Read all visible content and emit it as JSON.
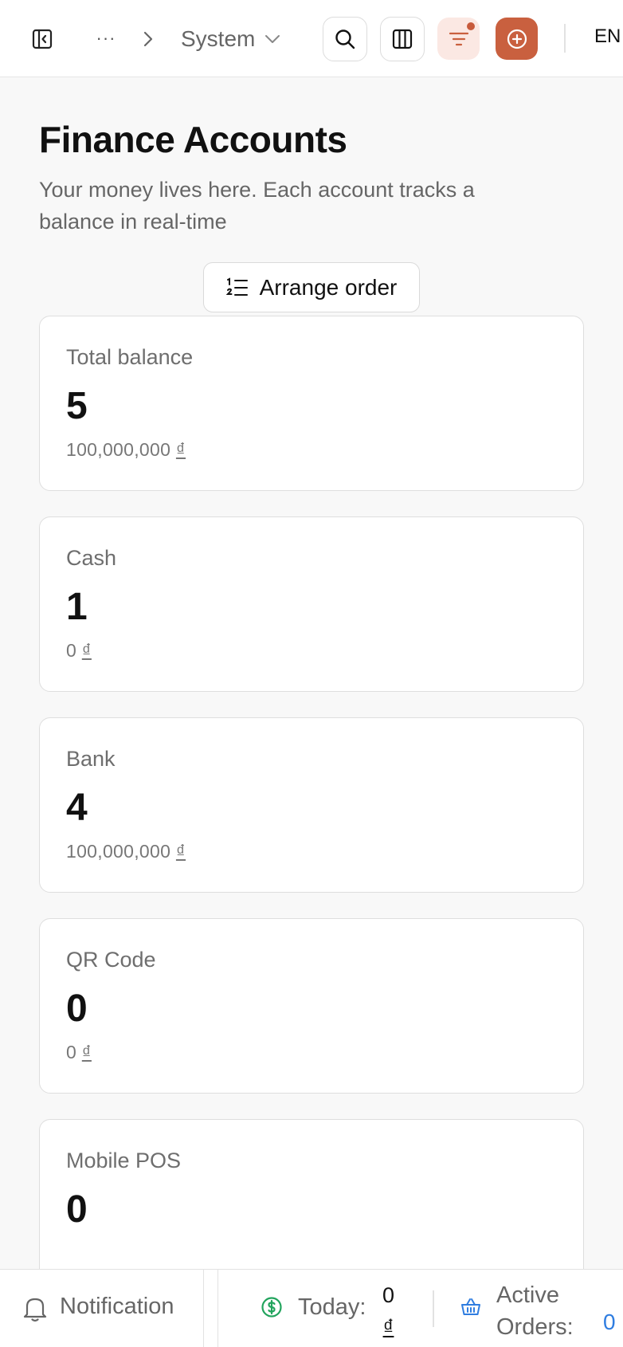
{
  "topbar": {
    "breadcrumb_current": "System",
    "language": "EN",
    "ellipsis": "···",
    "icons": [
      "sidebar-toggle-icon",
      "chevron-right-icon",
      "chevron-down-icon",
      "search-icon",
      "columns-icon",
      "filter-icon",
      "add-circle-icon"
    ],
    "accent_color": "#c9603f"
  },
  "page": {
    "title": "Finance Accounts",
    "subtitle": "Your money lives here. Each account tracks a balance in real-time",
    "arrange_button": "Arrange order"
  },
  "cards": [
    {
      "label": "Total balance",
      "count": "5",
      "amount": "100,000,000",
      "currency": "₫"
    },
    {
      "label": "Cash",
      "count": "1",
      "amount": "0",
      "currency": "₫"
    },
    {
      "label": "Bank",
      "count": "4",
      "amount": "100,000,000",
      "currency": "₫"
    },
    {
      "label": "QR Code",
      "count": "0",
      "amount": "0",
      "currency": "₫"
    },
    {
      "label": "Mobile POS",
      "count": "0",
      "amount": "",
      "currency": ""
    }
  ],
  "bottombar": {
    "notification_label": "Notification",
    "today_label": "Today:",
    "today_value": "0",
    "today_currency": "₫",
    "active_orders_line1": "Active",
    "active_orders_line2": "Orders:",
    "active_orders_value": "0"
  }
}
